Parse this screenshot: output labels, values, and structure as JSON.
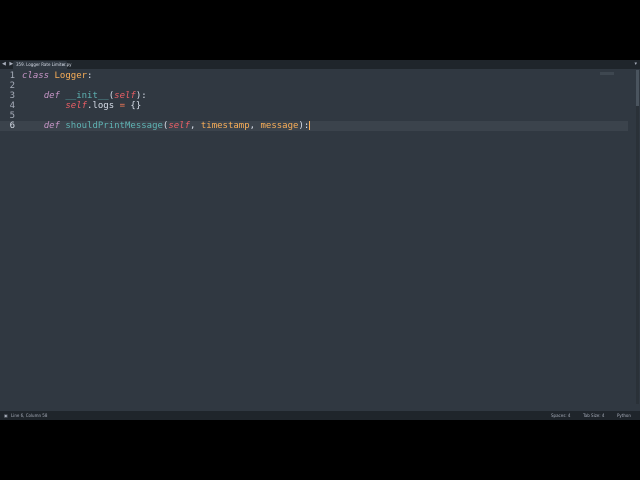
{
  "tabbar": {
    "nav_arrows": "◀ ▶",
    "tab_title": "359. Logger Rate Limiter.py",
    "tab_close": "×",
    "overflow_arrow": "▾"
  },
  "editor": {
    "line_numbers": [
      "1",
      "2",
      "3",
      "4",
      "5",
      "6"
    ],
    "active_line": 6
  },
  "statusbar": {
    "panel_icon": "▣",
    "position": "Line 6, Column 58",
    "spaces": "Spaces: 4",
    "tab_size": "Tab Size: 4",
    "language": "Python"
  }
}
